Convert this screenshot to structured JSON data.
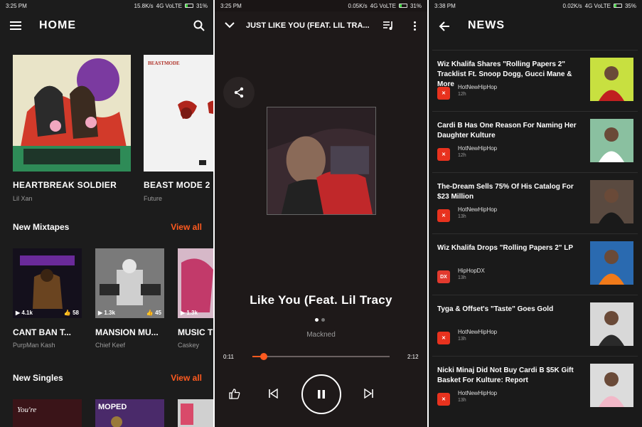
{
  "screen1": {
    "status": {
      "time": "3:25 PM",
      "net": "15.8K/s",
      "net_type": "4G VoLTE",
      "battery": "31%"
    },
    "title": "HOME",
    "albums": [
      {
        "title": "HEARTBREAK SOLDIER",
        "artist": "Lil Xan"
      },
      {
        "title": "BEAST MODE 2",
        "artist": "Future",
        "cover_text": "BEASTMODE"
      }
    ],
    "mixtapes_header": "New Mixtapes",
    "view_all": "View all",
    "mixtapes": [
      {
        "title": "CANT BAN T...",
        "artist": "PurpMan Kash",
        "plays": "4.1k",
        "likes": "58"
      },
      {
        "title": "MANSION MU...",
        "artist": "Chief Keef",
        "plays": "1.3k",
        "likes": "45"
      },
      {
        "title": "MUSIC T",
        "artist": "Caskey",
        "plays": "1.3k"
      }
    ],
    "singles_header": "New Singles",
    "singles_view_all": "View all",
    "single_cover_text": "MOPED"
  },
  "screen2": {
    "status": {
      "time": "3:25 PM",
      "net": "0.05K/s",
      "net_type": "4G VoLTE",
      "battery": "31%"
    },
    "now_playing_title": "JUST LIKE YOU (FEAT. LIL TRA...",
    "song_title": "Like You (Feat. Lil Tracy",
    "artist": "Mackned",
    "time_current": "0:11",
    "time_total": "2:12",
    "progress": 0.085
  },
  "screen3": {
    "status": {
      "time": "3:38 PM",
      "net": "0.02K/s",
      "net_type": "4G VoLTE",
      "battery": "35%"
    },
    "title": "NEWS",
    "items": [
      {
        "headline": "Wiz Khalifa Shares \"Rolling Papers 2\" Tracklist Ft. Snoop Dogg, Gucci Mane & More",
        "source": "HotNewHipHop",
        "age": "12h"
      },
      {
        "headline": "Cardi B Has One Reason For Naming Her Daughter Kulture",
        "source": "HotNewHipHop",
        "age": "12h"
      },
      {
        "headline": "The-Dream Sells 75% Of His Catalog For $23 Million",
        "source": "HotNewHipHop",
        "age": "13h"
      },
      {
        "headline": "Wiz Khalifa Drops \"Rolling Papers 2\" LP",
        "source": "HipHopDX",
        "age": "13h"
      },
      {
        "headline": "Tyga & Offset's \"Taste\" Goes Gold",
        "source": "HotNewHipHop",
        "age": "13h"
      },
      {
        "headline": "Nicki Minaj Did Not Buy Cardi B $5K Gift Basket For Kulture: Report",
        "source": "HotNewHipHop",
        "age": "13h"
      }
    ]
  },
  "colors": {
    "accent": "#ff5a1f",
    "hnhh_logo": "#e8321e",
    "hiphopdx_logo": "#e23a2e"
  }
}
